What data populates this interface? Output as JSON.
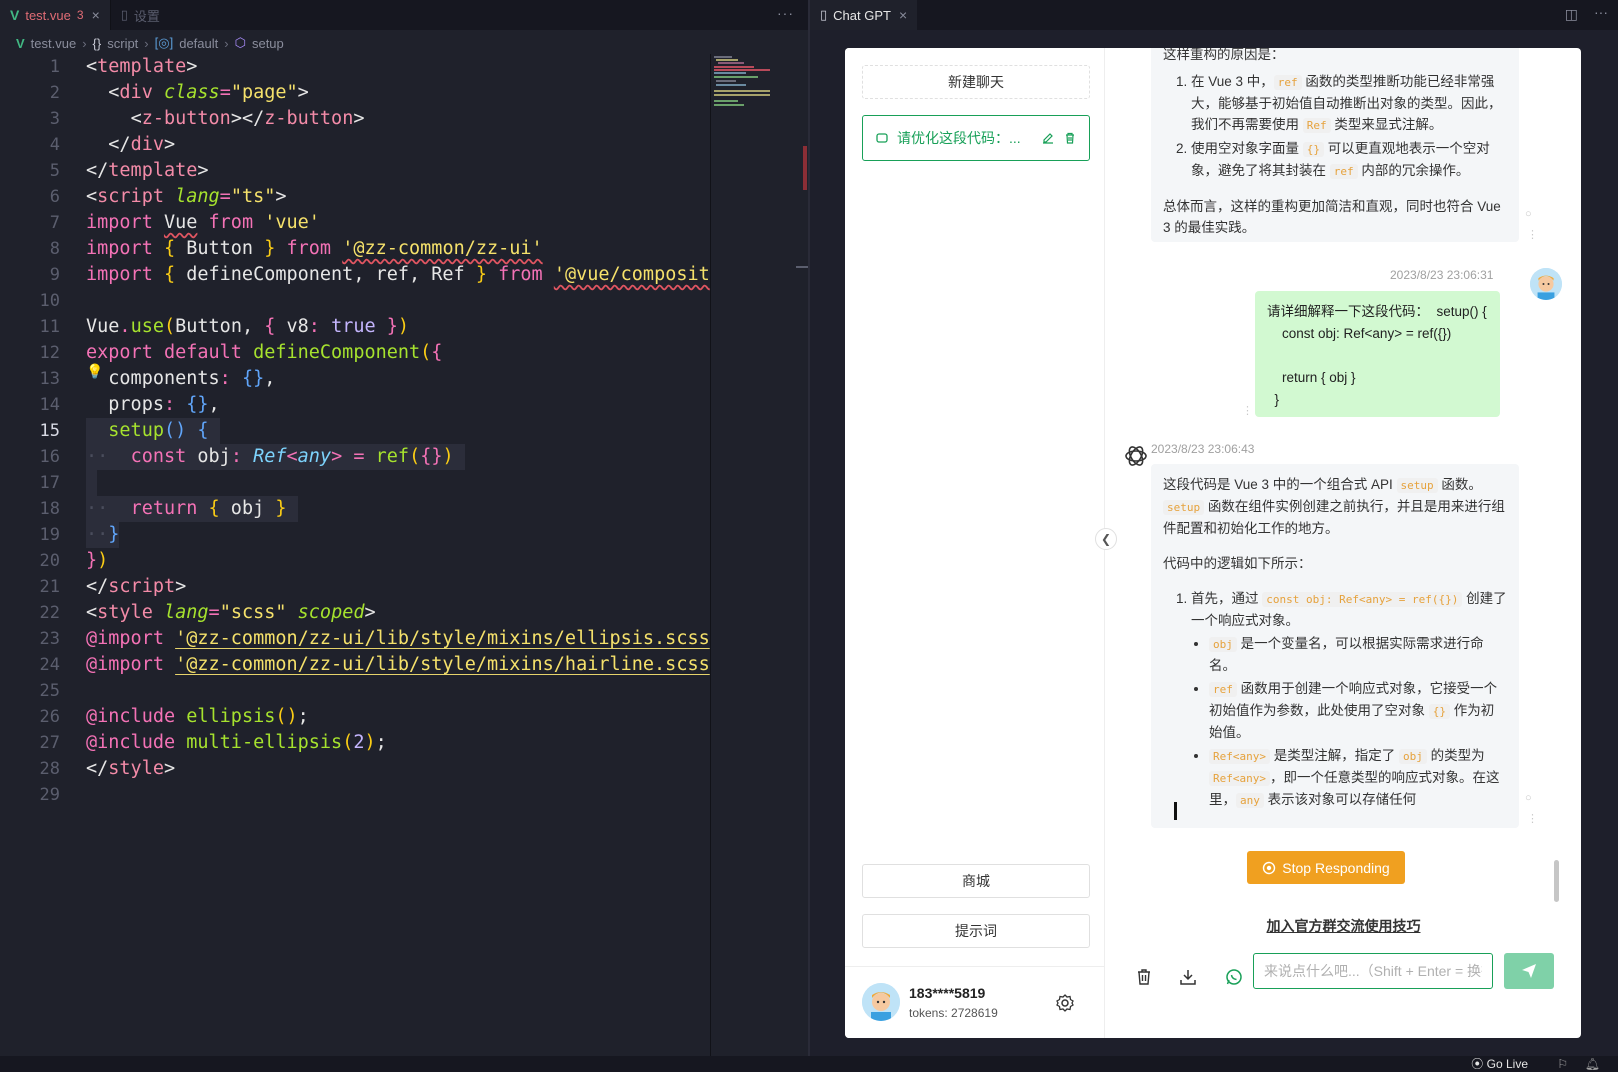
{
  "editor": {
    "tabs": [
      {
        "label": "test.vue",
        "count": "3",
        "active": true
      },
      {
        "label": "设置",
        "active": false
      }
    ],
    "breadcrumb": [
      "test.vue",
      "script",
      "default",
      "setup"
    ],
    "more": "···",
    "current_line": 15,
    "line_numbers": [
      "1",
      "2",
      "3",
      "4",
      "5",
      "6",
      "7",
      "8",
      "9",
      "10",
      "11",
      "12",
      "13",
      "14",
      "15",
      "16",
      "17",
      "18",
      "19",
      "20",
      "21",
      "22",
      "23",
      "24",
      "25",
      "26",
      "27",
      "28",
      "29"
    ]
  },
  "webview": {
    "tab_label": "Chat GPT",
    "sidebar": {
      "new_chat": "新建聊天",
      "chat_item": "请优化这段代码：...",
      "mall": "商城",
      "prompts": "提示词",
      "user_name": "183****5819",
      "tokens": "tokens: 2728619"
    },
    "messages": {
      "a1_intro": "这样重构的原因是：",
      "a1_list1_pre": "在 Vue 3 中，",
      "a1_list1_code": "ref",
      "a1_list1_post": " 函数的类型推断功能已经非常强大，能够基于初始值自动推断出对象的类型。因此，我们不再需要使用 ",
      "a1_list1_code2": "Ref",
      "a1_list1_end": " 类型来显式注解。",
      "a1_list2_pre": "使用空对象字面量 ",
      "a1_list2_code": "{}",
      "a1_list2_post": " 可以更直观地表示一个空对象，避免了将其封装在 ",
      "a1_list2_code2": "ref",
      "a1_list2_end": " 内部的冗余操作。",
      "a1_summary": "总体而言，这样的重构更加简洁和直观，同时也符合 Vue 3 的最佳实践。",
      "user_time": "2023/8/23 23:06:31",
      "user_text": "请详细解释一下这段代码：  setup() {\n    const obj: Ref<any> = ref({})\n\n    return { obj }\n  }",
      "a2_time": "2023/8/23 23:06:43",
      "a2_p1_pre": "这段代码是 Vue 3 中的一个组合式 API ",
      "a2_p1_code": "setup",
      "a2_p1_post": " 函数。",
      "a2_p1_code2": "setup",
      "a2_p1_end": " 函数在组件实例创建之前执行，并且是用来进行组件配置和初始化工作的地方。",
      "a2_p2": "代码中的逻辑如下所示：",
      "a2_li1_pre": "首先，通过 ",
      "a2_li1_code": "const obj: Ref<any> = ref({})",
      "a2_li1_post": " 创建了一个响应式对象。",
      "a2_sub1_code": "obj",
      "a2_sub1": " 是一个变量名，可以根据实际需求进行命名。",
      "a2_sub2_code": "ref",
      "a2_sub2_pre": " 函数用于创建一个响应式对象，它接受一个初始值作为参数，此处使用了空对象 ",
      "a2_sub2_code2": "{}",
      "a2_sub2_post": " 作为初始值。",
      "a2_sub3_code": "Ref<any>",
      "a2_sub3_pre": " 是类型注解，指定了 ",
      "a2_sub3_code2": "obj",
      "a2_sub3_mid": " 的类型为 ",
      "a2_sub3_code3": "Ref<any>",
      "a2_sub3_post": "，即一个任意类型的响应式对象。在这里，",
      "a2_sub3_code4": "any",
      "a2_sub3_end": " 表示该对象可以存储任何"
    },
    "stop_button": "Stop Responding",
    "join_link": "加入官方群交流使用技巧",
    "input_placeholder": "来说点什么吧...（Shift + Enter = 换行，'/' 触发提示词）"
  },
  "statusbar": {
    "golive": "Go Live"
  },
  "colors": {
    "accent_green": "#18a058",
    "stop_orange": "#f0a020",
    "user_bubble": "#d2f9d1"
  }
}
